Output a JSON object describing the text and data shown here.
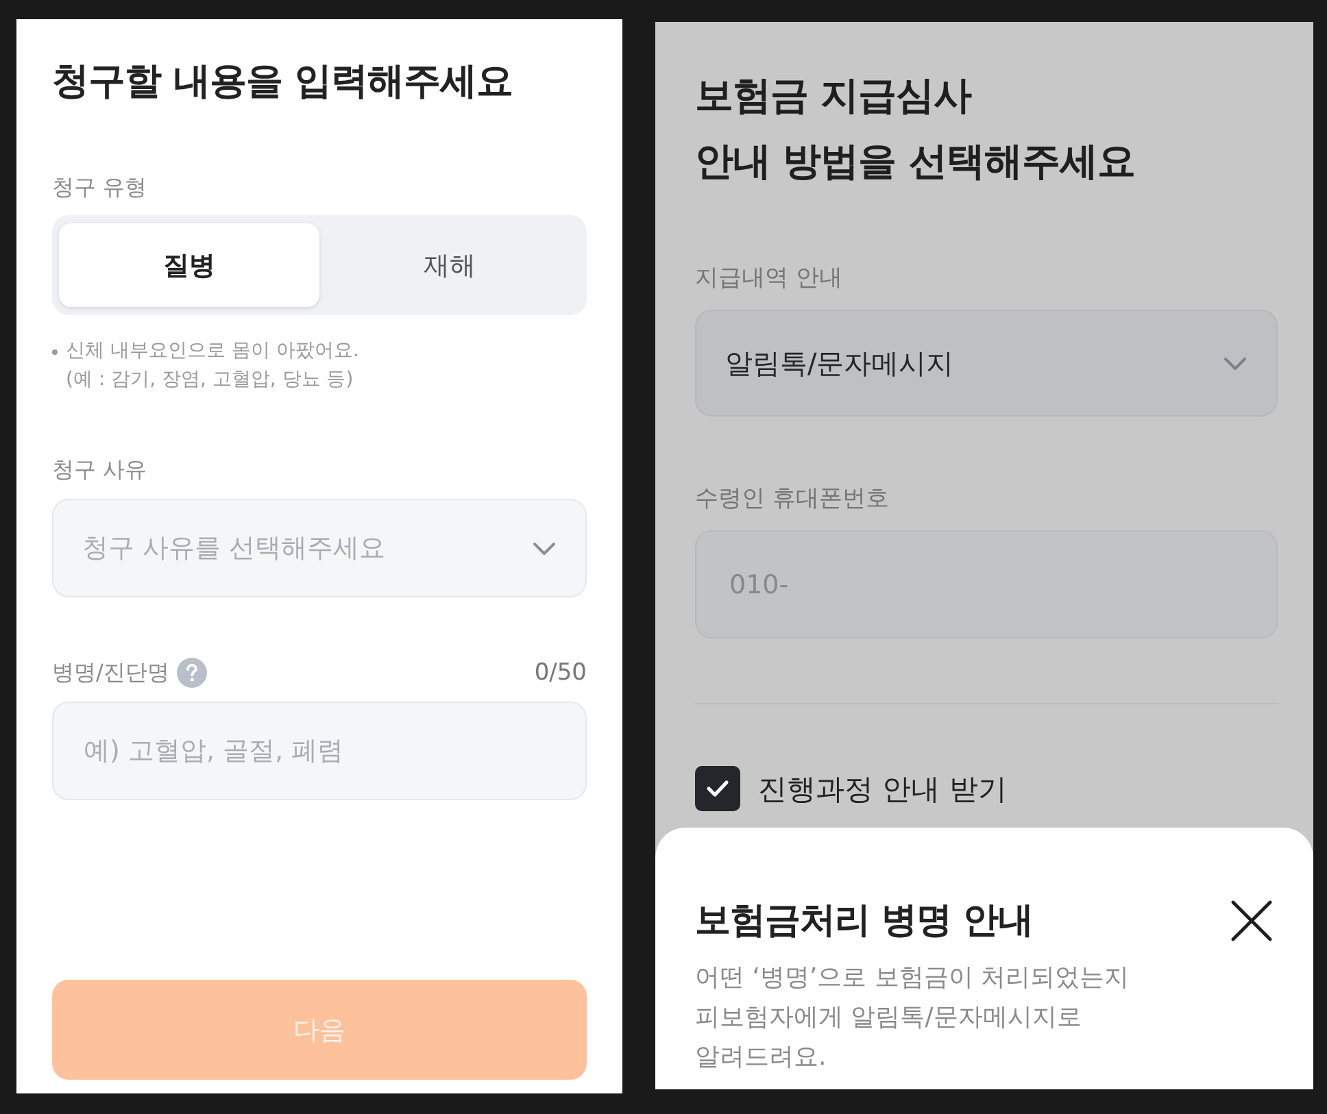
{
  "claim_form": {
    "title": "청구할 내용을 입력해주세요",
    "claim_type": {
      "label": "청구 유형",
      "options": [
        {
          "label": "질병",
          "selected": true
        },
        {
          "label": "재해",
          "selected": false
        }
      ],
      "note": "신체 내부요인으로 몸이 아팠어요.\n(예 : 감기, 장염, 고혈압, 당뇨 등)"
    },
    "claim_reason": {
      "label": "청구 사유",
      "placeholder": "청구 사유를 선택해주세요"
    },
    "diagnosis": {
      "label": "병명/진단명",
      "counter": "0/50",
      "placeholder": "예) 고혈압, 골절, 폐렴"
    },
    "next_button": {
      "label": "다음",
      "disabled": true
    }
  },
  "notice_settings": {
    "title": "보험금 지급심사\n안내 방법을 선택해주세요",
    "payment_notice": {
      "label": "지급내역 안내",
      "value": "알림톡/문자메시지"
    },
    "recipient_phone": {
      "label": "수령인 휴대폰번호",
      "value": "010-",
      "disabled": true
    },
    "progress_notice": {
      "label": "진행과정 안내 받기",
      "checked": true
    }
  },
  "bottom_sheet": {
    "title": "보험금처리 병명 안내",
    "description": "어떤 ‘병명’으로 보험금이 처리되었는지\n피보험자에게 알림톡/문자메시지로\n알려드려요."
  }
}
